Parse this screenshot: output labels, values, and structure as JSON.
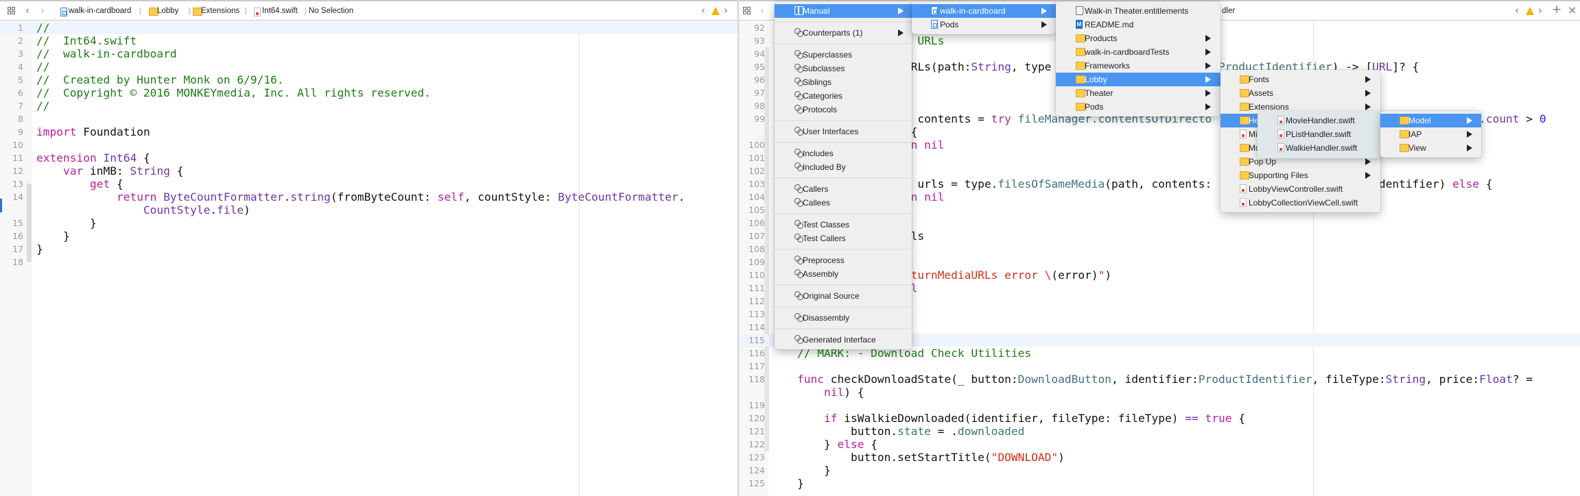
{
  "colors": {
    "menu_highlight": "#4a95f2",
    "comment": "#1d7d14",
    "keyword": "#b4219f",
    "type": "#6b36a8",
    "project_symbol": "#3e7278",
    "string": "#d12f1b",
    "number": "#2b1ccf",
    "warning": "#f5b400"
  },
  "left_editor": {
    "breadcrumb": [
      {
        "label": "walk-in-cardboard",
        "icon": "project-icon"
      },
      {
        "label": "Lobby",
        "icon": "folder-icon"
      },
      {
        "label": "Extensions",
        "icon": "folder-icon"
      },
      {
        "label": "Int64.swift",
        "icon": "swift-file-icon"
      },
      {
        "label": "No Selection",
        "icon": ""
      }
    ],
    "current_line": 1,
    "rows": [
      {
        "n": "1",
        "tokens": [
          [
            "//",
            "c"
          ]
        ]
      },
      {
        "n": "2",
        "tokens": [
          [
            "//  Int64.swift",
            "c"
          ]
        ]
      },
      {
        "n": "3",
        "tokens": [
          [
            "//  walk-in-cardboard",
            "c"
          ]
        ]
      },
      {
        "n": "4",
        "tokens": [
          [
            "//",
            "c"
          ]
        ]
      },
      {
        "n": "5",
        "tokens": [
          [
            "//  Created by Hunter Monk on 6/9/16.",
            "c"
          ]
        ]
      },
      {
        "n": "6",
        "tokens": [
          [
            "//  Copyright © 2016 MONKEYmedia, Inc. All rights reserved.",
            "c"
          ]
        ]
      },
      {
        "n": "7",
        "tokens": [
          [
            "//",
            "c"
          ]
        ]
      },
      {
        "n": "8",
        "tokens": []
      },
      {
        "n": "9",
        "tokens": [
          [
            "import",
            "k"
          ],
          [
            " Foundation",
            ""
          ]
        ]
      },
      {
        "n": "10",
        "tokens": []
      },
      {
        "n": "11",
        "tokens": [
          [
            "extension",
            "k"
          ],
          [
            " ",
            ""
          ],
          [
            "Int64",
            "t"
          ],
          [
            " {",
            ""
          ]
        ]
      },
      {
        "n": "12",
        "tokens": [
          [
            "    ",
            ""
          ],
          [
            "var",
            "k"
          ],
          [
            " inMB: ",
            ""
          ],
          [
            "String",
            "t"
          ],
          [
            " {",
            ""
          ]
        ]
      },
      {
        "n": "13",
        "tokens": [
          [
            "        ",
            ""
          ],
          [
            "get",
            "k"
          ],
          [
            " {",
            ""
          ]
        ]
      },
      {
        "n": "14",
        "tokens": [
          [
            "            ",
            ""
          ],
          [
            "return",
            "k"
          ],
          [
            " ",
            ""
          ],
          [
            "ByteCountFormatter",
            "t"
          ],
          [
            ".",
            ""
          ],
          [
            "string",
            "t"
          ],
          [
            "(fromByteCount: ",
            ""
          ],
          [
            "self",
            "k"
          ],
          [
            ", countStyle: ",
            ""
          ],
          [
            "ByteCountFormatter",
            "t"
          ],
          [
            ".",
            ""
          ]
        ]
      },
      {
        "n": "",
        "tokens": [
          [
            "                ",
            ""
          ],
          [
            "CountStyle",
            "t"
          ],
          [
            ".",
            ""
          ],
          [
            "file",
            "t"
          ],
          [
            ")",
            ""
          ]
        ]
      },
      {
        "n": "15",
        "tokens": [
          [
            "        }",
            ""
          ]
        ]
      },
      {
        "n": "16",
        "tokens": [
          [
            "    }",
            ""
          ]
        ]
      },
      {
        "n": "17",
        "tokens": [
          [
            "}",
            ""
          ]
        ]
      },
      {
        "n": "18",
        "tokens": []
      }
    ]
  },
  "right_editor": {
    "breadcrumb_tail": "dler",
    "current_line": 115,
    "rows": [
      {
        "n": "92",
        "tokens": []
      },
      {
        "n": "93",
        "tokens": [
          [
            "                      ",
            ""
          ],
          [
            "URLs",
            "c"
          ]
        ]
      },
      {
        "n": "94",
        "tokens": []
      },
      {
        "n": "95",
        "tokens": [
          [
            "                     RLs(path:",
            ""
          ],
          [
            "String",
            "t"
          ],
          [
            ", type                         ",
            ""
          ],
          [
            "ProductIdentifier",
            "t2"
          ],
          [
            ") -> [",
            ""
          ],
          [
            "URL",
            "t"
          ],
          [
            "]? {",
            ""
          ]
        ]
      },
      {
        "n": "96",
        "tokens": []
      },
      {
        "n": "97",
        "tokens": []
      },
      {
        "n": "98",
        "tokens": []
      },
      {
        "n": "99",
        "tokens": [
          [
            "                      contents = ",
            ""
          ],
          [
            "try",
            "k"
          ],
          [
            " ",
            ""
          ],
          [
            "fileManager.contentsOfDirecto",
            "t2"
          ],
          [
            "                                        ",
            ""
          ],
          [
            ".count",
            "t"
          ],
          [
            " > ",
            ""
          ],
          [
            "0",
            "num"
          ]
        ]
      },
      {
        "n": "",
        "tokens": [
          [
            "                     {",
            ""
          ]
        ]
      },
      {
        "n": "100",
        "tokens": [
          [
            "                     n nil",
            "k"
          ]
        ]
      },
      {
        "n": "101",
        "tokens": []
      },
      {
        "n": "102",
        "tokens": []
      },
      {
        "n": "103",
        "tokens": [
          [
            "                      urls = type.",
            ""
          ],
          [
            "filesOfSameMedia",
            "t2"
          ],
          [
            "(path, contents:                         dentifier) ",
            ""
          ],
          [
            "else",
            "k"
          ],
          [
            " {",
            ""
          ]
        ]
      },
      {
        "n": "104",
        "tokens": [
          [
            "                     n nil",
            "k"
          ]
        ]
      },
      {
        "n": "105",
        "tokens": []
      },
      {
        "n": "106",
        "tokens": []
      },
      {
        "n": "107",
        "tokens": [
          [
            "                     ls",
            ""
          ]
        ]
      },
      {
        "n": "108",
        "tokens": []
      },
      {
        "n": "109",
        "tokens": []
      },
      {
        "n": "110",
        "tokens": [
          [
            "                     ",
            ""
          ],
          [
            "turnMediaURLs error \\",
            "s"
          ],
          [
            "(error)",
            ""
          ],
          [
            "\"",
            "s"
          ],
          [
            ")",
            ""
          ]
        ]
      },
      {
        "n": "111",
        "tokens": [
          [
            "                     l",
            "k"
          ]
        ]
      },
      {
        "n": "112",
        "tokens": []
      },
      {
        "n": "113",
        "tokens": []
      },
      {
        "n": "114",
        "tokens": []
      },
      {
        "n": "115",
        "tokens": []
      },
      {
        "n": "116",
        "tokens": [
          [
            "    // MARK: - Download Check Utilities",
            "c"
          ]
        ]
      },
      {
        "n": "117",
        "tokens": []
      },
      {
        "n": "118",
        "tokens": [
          [
            "    ",
            ""
          ],
          [
            "func",
            "k"
          ],
          [
            " checkDownloadState(_ button:",
            ""
          ],
          [
            "DownloadButton",
            "t2"
          ],
          [
            ", identifier:",
            ""
          ],
          [
            "ProductIdentifier",
            "t2"
          ],
          [
            ", fileType:",
            ""
          ],
          [
            "String",
            "t"
          ],
          [
            ", price:",
            ""
          ],
          [
            "Float",
            "t"
          ],
          [
            "? =",
            ""
          ]
        ]
      },
      {
        "n": "",
        "tokens": [
          [
            "        ",
            ""
          ],
          [
            "nil",
            "k"
          ],
          [
            ") {",
            ""
          ]
        ]
      },
      {
        "n": "119",
        "tokens": []
      },
      {
        "n": "120",
        "tokens": [
          [
            "        ",
            ""
          ],
          [
            "if",
            "k"
          ],
          [
            " isWalkieDownloaded(identifier, fileType: fileType) ",
            ""
          ],
          [
            "==",
            "t"
          ],
          [
            " ",
            ""
          ],
          [
            "true",
            "k"
          ],
          [
            " {",
            ""
          ]
        ]
      },
      {
        "n": "121",
        "tokens": [
          [
            "            button.",
            ""
          ],
          [
            "state",
            "t2"
          ],
          [
            " = .",
            ""
          ],
          [
            "downloaded",
            "t2"
          ]
        ]
      },
      {
        "n": "122",
        "tokens": [
          [
            "        } ",
            ""
          ],
          [
            "else",
            "k"
          ],
          [
            " {",
            ""
          ]
        ]
      },
      {
        "n": "123",
        "tokens": [
          [
            "            button.setStartTitle(",
            ""
          ],
          [
            "\"DOWNLOAD\"",
            "s"
          ],
          [
            ")",
            ""
          ]
        ]
      },
      {
        "n": "124",
        "tokens": [
          [
            "        }",
            ""
          ]
        ]
      },
      {
        "n": "125",
        "tokens": [
          [
            "    }",
            ""
          ]
        ]
      }
    ]
  },
  "menus": {
    "related": [
      {
        "label": "Manual",
        "icon": "manual",
        "arrow": true,
        "hl": true
      },
      {
        "sep": true
      },
      {
        "label": "Counterparts (1)",
        "icon": "related",
        "arrow": true
      },
      {
        "sep": true
      },
      {
        "label": "Superclasses",
        "icon": "related"
      },
      {
        "label": "Subclasses",
        "icon": "related"
      },
      {
        "label": "Siblings",
        "icon": "related"
      },
      {
        "label": "Categories",
        "icon": "related"
      },
      {
        "label": "Protocols",
        "icon": "related"
      },
      {
        "sep": true
      },
      {
        "label": "User Interfaces",
        "icon": "related"
      },
      {
        "sep": true
      },
      {
        "label": "Includes",
        "icon": "related"
      },
      {
        "label": "Included By",
        "icon": "related"
      },
      {
        "sep": true
      },
      {
        "label": "Callers",
        "icon": "related"
      },
      {
        "label": "Callees",
        "icon": "related"
      },
      {
        "sep": true
      },
      {
        "label": "Test Classes",
        "icon": "related"
      },
      {
        "label": "Test Callers",
        "icon": "related"
      },
      {
        "sep": true
      },
      {
        "label": "Preprocess",
        "icon": "related"
      },
      {
        "label": "Assembly",
        "icon": "related"
      },
      {
        "sep": true
      },
      {
        "label": "Original Source",
        "icon": "related"
      },
      {
        "sep": true
      },
      {
        "label": "Disassembly",
        "icon": "related"
      },
      {
        "sep": true
      },
      {
        "label": "Generated Interface",
        "icon": "related"
      }
    ],
    "projects": [
      {
        "label": "walk-in-cardboard",
        "icon": "project",
        "arrow": true,
        "hl": true
      },
      {
        "label": "Pods",
        "icon": "project",
        "arrow": true
      }
    ],
    "project_root": [
      {
        "label": "Walk-in Theater.entitlements",
        "icon": "ent"
      },
      {
        "label": "README.md",
        "icon": "md"
      },
      {
        "label": "Products",
        "icon": "folder",
        "arrow": true
      },
      {
        "label": "walk-in-cardboardTests",
        "icon": "folder",
        "arrow": true
      },
      {
        "label": "Frameworks",
        "icon": "folder",
        "arrow": true
      },
      {
        "label": "Lobby",
        "icon": "folder",
        "arrow": true,
        "hl": true
      },
      {
        "label": "Theater",
        "icon": "folder",
        "arrow": true
      },
      {
        "label": "Pods",
        "icon": "folder",
        "arrow": true
      }
    ],
    "lobby": [
      {
        "label": "Fonts",
        "icon": "folder",
        "arrow": true
      },
      {
        "label": "Assets",
        "icon": "folder",
        "arrow": true
      },
      {
        "label": "Extensions",
        "icon": "folder",
        "arrow": true
      },
      {
        "label": "He",
        "icon": "folder",
        "arrow": true,
        "hl": true
      },
      {
        "label": "Mi",
        "icon": "swift"
      },
      {
        "label": "Mo",
        "icon": "folder",
        "arrow": true
      },
      {
        "label": "Pop Up",
        "icon": "folder",
        "arrow": true
      },
      {
        "label": "Supporting Files",
        "icon": "folder",
        "arrow": true
      },
      {
        "label": "LobbyViewController.swift",
        "icon": "swift"
      },
      {
        "label": "LobbyCollectionViewCell.swift",
        "icon": "swift"
      }
    ],
    "handler_files": [
      {
        "label": "MovieHandler.swift",
        "icon": "swift"
      },
      {
        "label": "PListHandler.swift",
        "icon": "swift"
      },
      {
        "label": "WalkieHandler.swift",
        "icon": "swift"
      }
    ],
    "handler_folders": [
      {
        "label": "Model",
        "icon": "folder",
        "arrow": true,
        "hl": true
      },
      {
        "label": "IAP",
        "icon": "folder",
        "arrow": true
      },
      {
        "label": "View",
        "icon": "folder",
        "arrow": true
      }
    ]
  },
  "icons": {
    "related_files": "grid-icon",
    "back": "‹",
    "forward": "›",
    "add": "+",
    "close": "×"
  }
}
